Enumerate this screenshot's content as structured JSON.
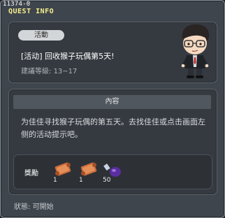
{
  "window": {
    "quest_id": "11374-0",
    "title": "QUEST INFO"
  },
  "quest": {
    "badge": "活動",
    "name": "[活动] 回收猴子玩偶第5天!",
    "level_label": "建議等級:",
    "level_range": "13~17"
  },
  "content": {
    "header": "內容",
    "description": "为佳佳寻找猴子玩偶的第五天。去找佳佳或点击画面左侧的活动提示吧。"
  },
  "reward": {
    "label": "獎勵",
    "items": [
      {
        "icon": "scroll-icon",
        "count": "1"
      },
      {
        "icon": "scroll-icon",
        "count": "1"
      },
      {
        "icon": "potion-icon",
        "count": "50"
      }
    ]
  },
  "status": {
    "label": "狀態:",
    "value": "可開始"
  }
}
